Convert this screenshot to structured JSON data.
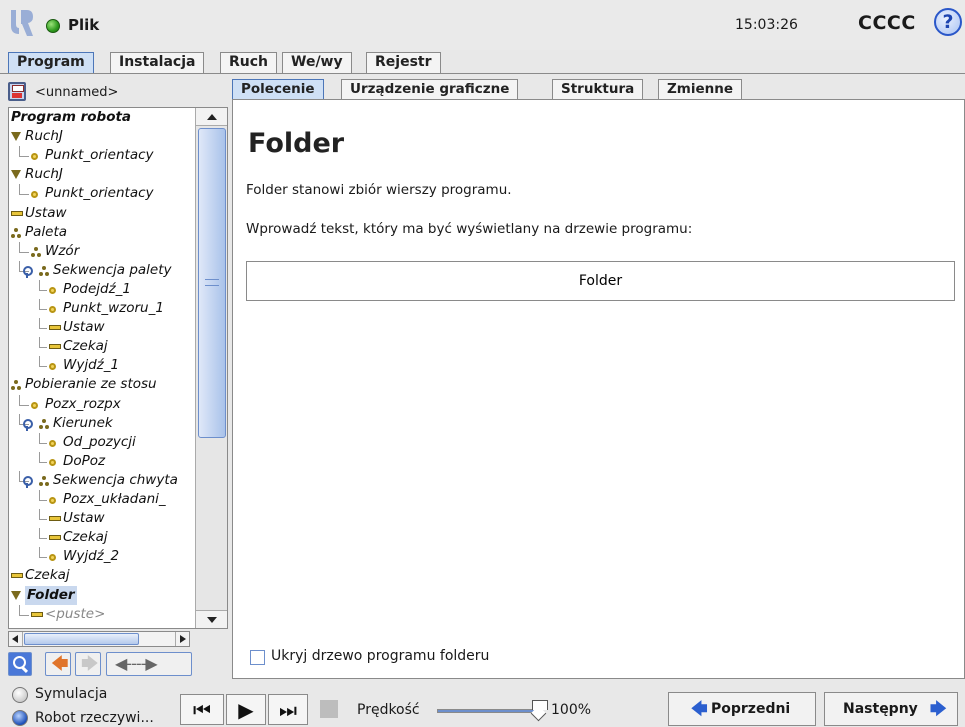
{
  "header": {
    "menu_label": "Plik",
    "time": "15:03:26",
    "robot_name": "CCCC",
    "help_symbol": "?",
    "status_color": "#2e9a1e",
    "logo_icon": "ur-logo-icon"
  },
  "main_tabs": [
    "Program",
    "Instalacja",
    "Ruch",
    "We/wy",
    "Rejestr"
  ],
  "main_tab_active": "Program",
  "file": {
    "name": "<unnamed>",
    "icon": "save-icon"
  },
  "tree": {
    "nodes": [
      {
        "label": "Program robota",
        "icon": "none",
        "root": true
      },
      {
        "label": "RuchJ",
        "icon": "triangle"
      },
      {
        "label": "Punkt_orientacy",
        "icon": "waypoint"
      },
      {
        "label": "RuchJ",
        "icon": "triangle"
      },
      {
        "label": "Punkt_orientacy",
        "icon": "waypoint"
      },
      {
        "label": "Ustaw",
        "icon": "bar"
      },
      {
        "label": "Paleta",
        "icon": "pallet"
      },
      {
        "label": "Wzór",
        "icon": "pallet"
      },
      {
        "label": "Sekwencja palety",
        "icon": "pallet"
      },
      {
        "label": "Podejdź_1",
        "icon": "waypoint"
      },
      {
        "label": "Punkt_wzoru_1",
        "icon": "waypoint"
      },
      {
        "label": "Ustaw",
        "icon": "bar"
      },
      {
        "label": "Czekaj",
        "icon": "bar"
      },
      {
        "label": "Wyjdź_1",
        "icon": "waypoint"
      },
      {
        "label": "Pobieranie ze stosu",
        "icon": "pallet"
      },
      {
        "label": "Pozx_rozpx",
        "icon": "waypoint"
      },
      {
        "label": "Kierunek",
        "icon": "pallet"
      },
      {
        "label": "Od_pozycji",
        "icon": "waypoint"
      },
      {
        "label": "DoPoz",
        "icon": "waypoint"
      },
      {
        "label": "Sekwencja chwyta",
        "icon": "pallet"
      },
      {
        "label": "Pozx_układani_",
        "icon": "waypoint"
      },
      {
        "label": "Ustaw",
        "icon": "bar"
      },
      {
        "label": "Czekaj",
        "icon": "bar"
      },
      {
        "label": "Wyjdź_2",
        "icon": "waypoint"
      },
      {
        "label": "Czekaj",
        "icon": "bar"
      },
      {
        "label": "Folder",
        "icon": "triangle",
        "selected": true
      },
      {
        "label": "<puste>",
        "icon": "bar",
        "empty": true
      }
    ]
  },
  "tree_toolbar": {
    "search_icon": "search-icon",
    "undo_symbol": "🡄",
    "redo_symbol": "🡆",
    "move_symbol": "◀----▶"
  },
  "sub_tabs": [
    "Polecenie",
    "Urządzenie graficzne",
    "Struktura",
    "Zmienne"
  ],
  "sub_tab_active": "Polecenie",
  "content": {
    "title": "Folder",
    "description": "Folder stanowi zbiór wierszy programu.",
    "prompt": "Wprowadź tekst, który ma być wyświetlany na drzewie programu:",
    "field_value": "Folder",
    "checkbox_label": "Ukryj drzewo programu folderu",
    "checkbox_checked": false
  },
  "footer": {
    "simulation_label": "Symulacja",
    "real_robot_label": "Robot rzeczywi...",
    "speed_label": "Prędkość",
    "speed_value": "100%",
    "speed_fraction": 1.0,
    "prev_label": "Poprzedni",
    "next_label": "Następny",
    "accent_color": "#2b5fcf"
  }
}
